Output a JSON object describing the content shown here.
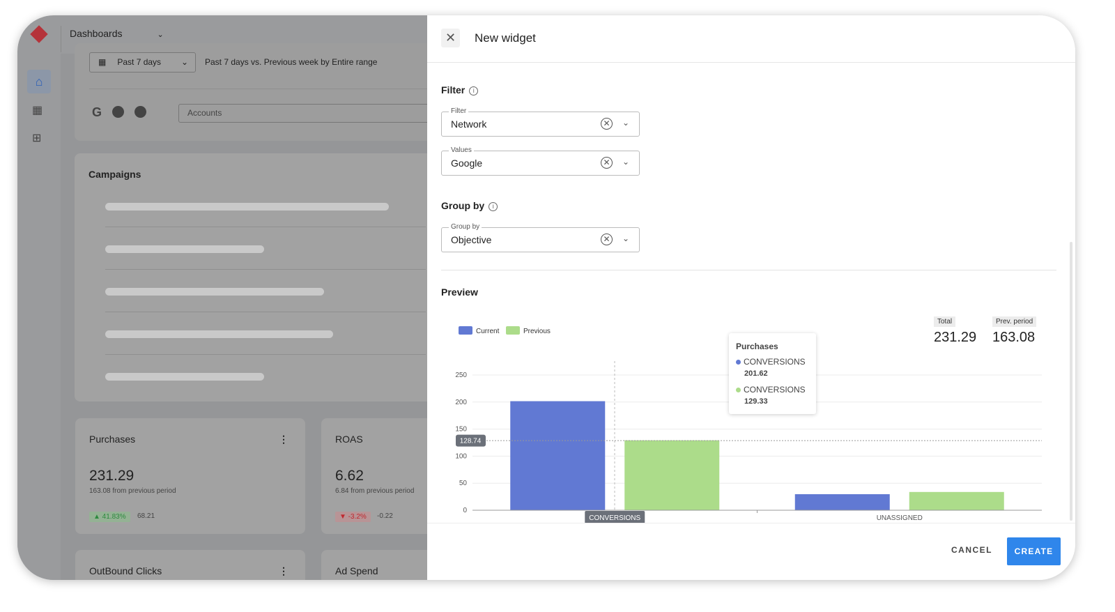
{
  "app": {
    "title": "Dashboards",
    "date_range": "Past 7 days",
    "comparison": "Past 7 days vs. Previous week by Entire range",
    "accounts_placeholder": "Accounts",
    "campaigns_title": "Campaigns"
  },
  "sidebar": {
    "items": [
      {
        "icon": "home-icon"
      },
      {
        "icon": "dashboard-grid-icon"
      },
      {
        "icon": "add-widget-icon"
      }
    ]
  },
  "networks": [
    "google-icon",
    "pinterest-icon",
    "facebook-icon"
  ],
  "cards": [
    {
      "title": "Purchases",
      "value": "231.29",
      "sub": "163.08 from previous period",
      "badge": "▲ 41.83%",
      "delta": "68.21",
      "trend": "up"
    },
    {
      "title": "ROAS",
      "value": "6.62",
      "sub": "6.84 from previous period",
      "badge": "▼ -3.2%",
      "delta": "-0.22",
      "trend": "down"
    },
    {
      "title": "OutBound Clicks"
    },
    {
      "title": "Ad Spend"
    }
  ],
  "dialog": {
    "title": "New widget",
    "filter_section": "Filter",
    "filter": {
      "label": "Filter",
      "value": "Network"
    },
    "values": {
      "label": "Values",
      "value": "Google"
    },
    "group_section": "Group by",
    "group_by": {
      "label": "Group by",
      "value": "Objective"
    },
    "preview": "Preview",
    "total_label": "Total",
    "total": "231.29",
    "prev_label": "Prev. period",
    "prev": "163.08",
    "tooltip": {
      "title": "Purchases",
      "rows": [
        {
          "label": "CONVERSIONS",
          "value": "201.62"
        },
        {
          "label": "CONVERSIONS",
          "value": "129.33"
        }
      ]
    },
    "crosshair_label": "128.74",
    "cancel": "CANCEL",
    "create": "CREATE"
  },
  "colors": {
    "current": "#6179d3",
    "previous": "#acdc8a",
    "create": "#2f86eb"
  },
  "chart_data": {
    "type": "bar",
    "categories": [
      "CONVERSIONS",
      "UNASSIGNED"
    ],
    "series": [
      {
        "name": "Current",
        "values": [
          201.62,
          29.67
        ]
      },
      {
        "name": "Previous",
        "values": [
          129.33,
          33.75
        ]
      }
    ],
    "ylim": [
      0,
      250
    ],
    "yticks": [
      0,
      50,
      100,
      150,
      200,
      250
    ],
    "grid": true,
    "legend": "top-left"
  }
}
